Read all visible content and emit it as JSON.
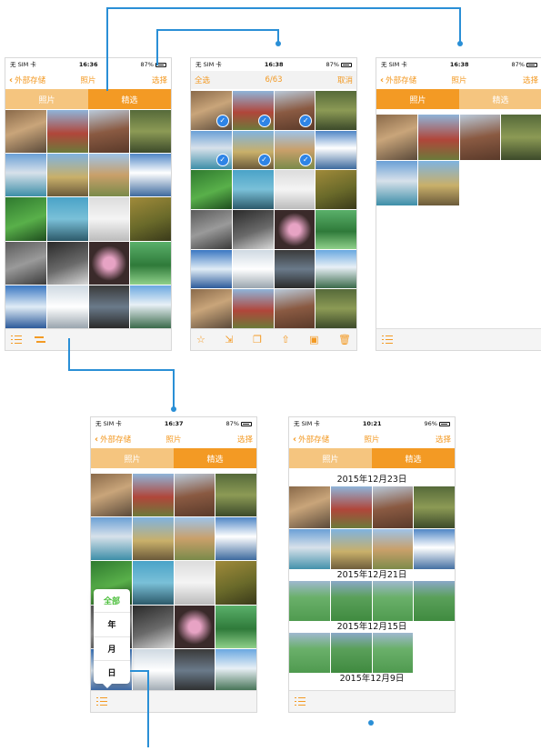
{
  "phone1": {
    "carrier": "无 SIM 卡",
    "time": "16:36",
    "battery": "87%",
    "back_label": "外部存储",
    "title": "照片",
    "select_label": "选择",
    "tab_photos": "照片",
    "tab_featured": "精选"
  },
  "phone2": {
    "carrier": "无 SIM 卡",
    "time": "16:38",
    "battery": "87%",
    "select_all": "全选",
    "count": "6/63",
    "cancel": "取消"
  },
  "phone3": {
    "carrier": "无 SIM 卡",
    "time": "16:38",
    "battery": "87%",
    "back_label": "外部存储",
    "title": "照片",
    "select_label": "选择",
    "tab_photos": "照片",
    "tab_featured": "精选"
  },
  "phone4": {
    "carrier": "无 SIM 卡",
    "time": "16:37",
    "battery": "87%",
    "back_label": "外部存储",
    "title": "照片",
    "select_label": "选择",
    "tab_photos": "照片",
    "tab_featured": "精选",
    "menu": [
      "全部",
      "年",
      "月",
      "日"
    ]
  },
  "phone5": {
    "carrier": "无 SIM 卡",
    "time": "10:21",
    "battery": "96%",
    "back_label": "外部存储",
    "title": "照片",
    "select_label": "选择",
    "tab_photos": "照片",
    "tab_featured": "精选",
    "dates": [
      "2015年12月23日",
      "2015年12月21日",
      "2015年12月15日",
      "2015年12月9日"
    ]
  },
  "colors": {
    "accent": "#f39a24",
    "connector": "#2a8fd6",
    "check": "#2e84e6",
    "menu_active": "#4cbf3c"
  }
}
